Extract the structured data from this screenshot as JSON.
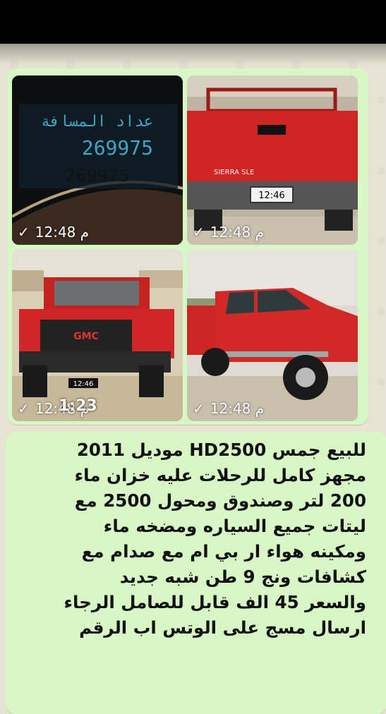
{
  "photos": [
    {
      "time": "12:48 م",
      "status": "sent",
      "odometer_text": "269975",
      "odometer_label": "عداد المسافة"
    },
    {
      "time": "12:48 م",
      "status": "sent",
      "stamp": "12:46",
      "brand": "SIERRA SLE"
    },
    {
      "time": "12:48 م",
      "status": "sent",
      "stamp": "12:46",
      "overlay": "1:23",
      "brand": "GMC"
    },
    {
      "time": "12:48 م",
      "status": "sent"
    }
  ],
  "message": {
    "lines": [
      "للبيع جمس HD2500 موديل 2011",
      "مجهز كامل للرحلات عليه خزان ماء",
      "200 لتر وصندوق ومحول 2500 مع",
      "ليتات جميع السياره ومضخه ماء",
      "ومكينه هواء ار بي ام مع صدام مع",
      "كشافات ونج 9 طن شبه جديد",
      "والسعر 45 الف قابل للصامل الرجاء",
      "ارسال مسج على الوتس اب الرقم"
    ]
  },
  "colors": {
    "bubble": "#d7f7c4",
    "background": "#e9e3d5",
    "topbar": "#000000"
  }
}
